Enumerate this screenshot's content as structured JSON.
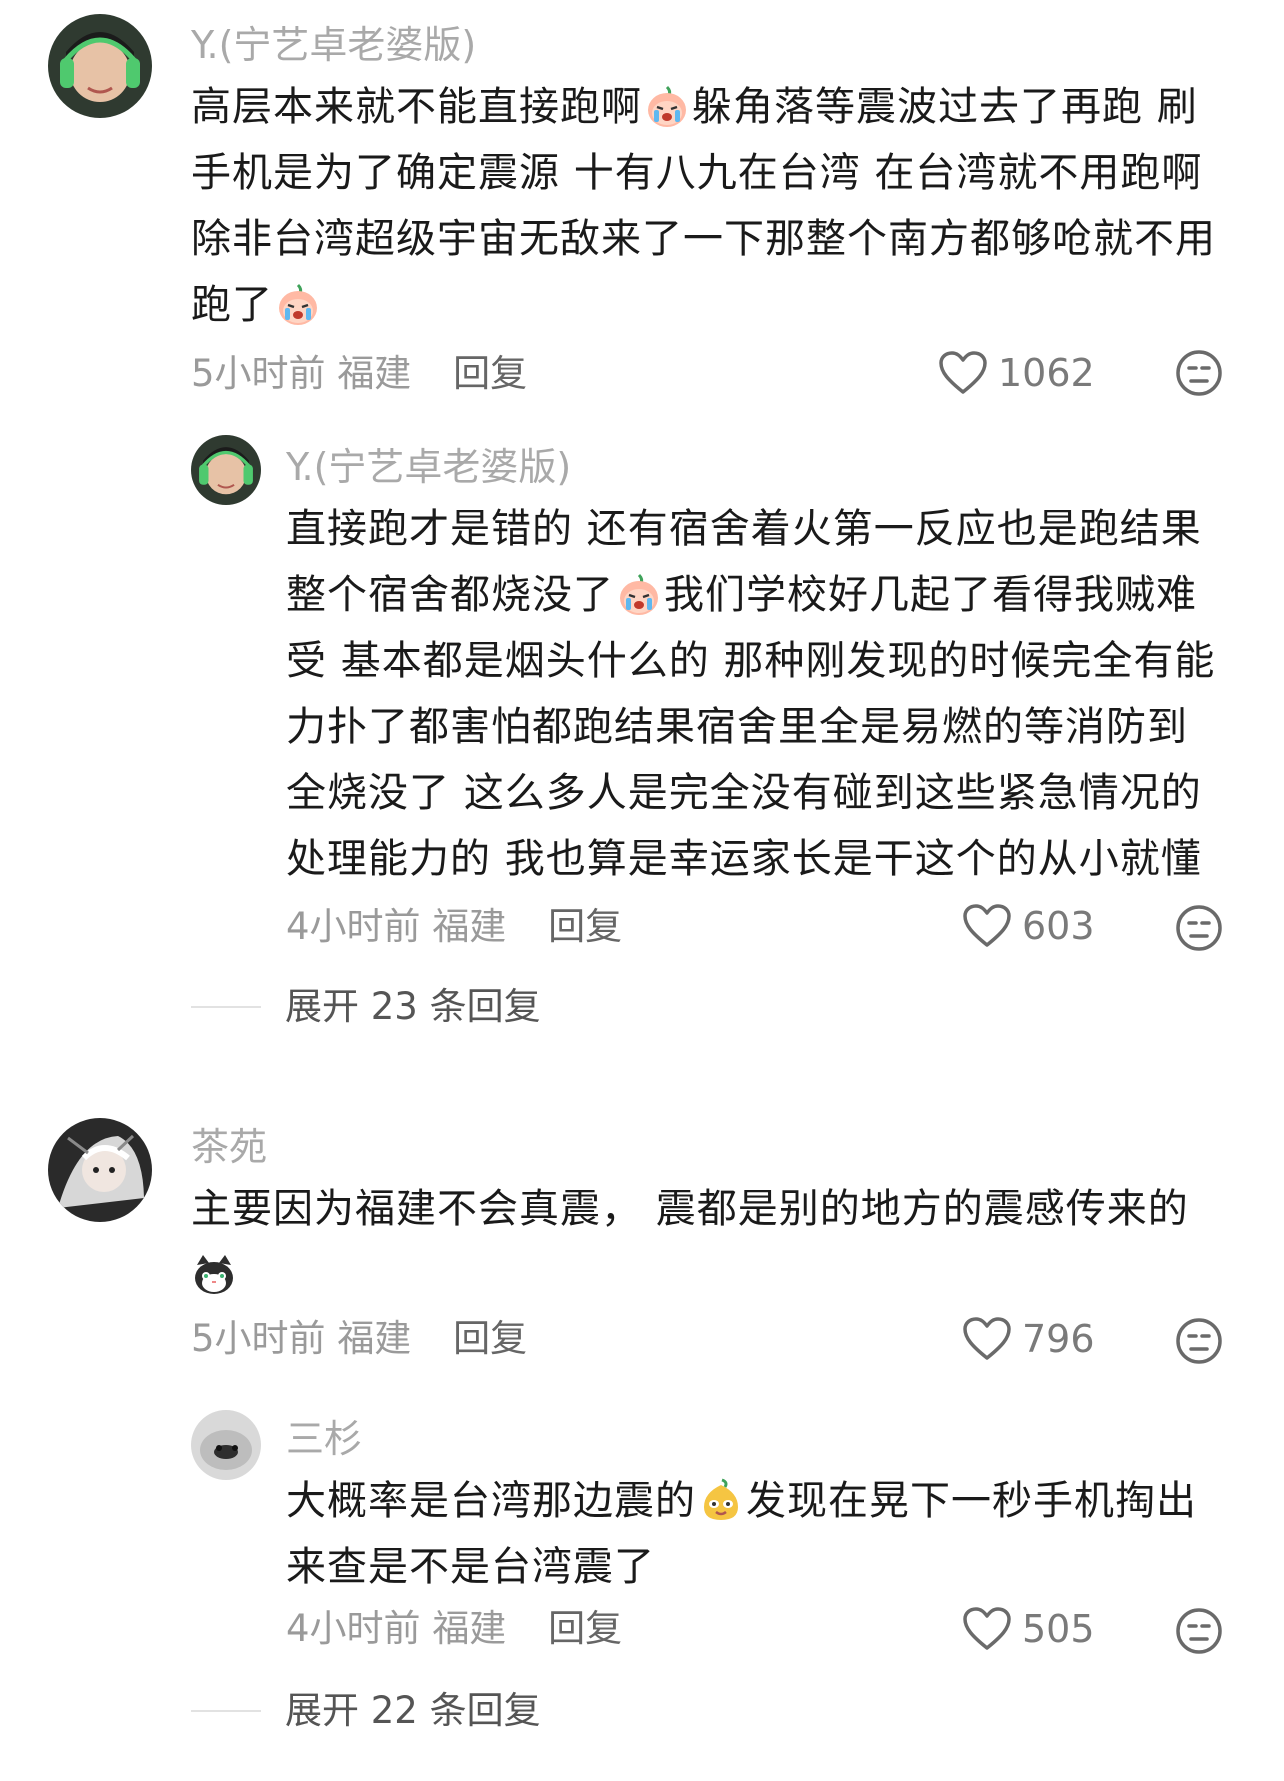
{
  "comments": [
    {
      "username": "Y.(宁艺卓老婆版)",
      "lines": [
        [
          "高层本来就不能直接跑啊",
          "躲角落等震波过去了再跑 刷"
        ],
        [
          "手机是为了确定震源 十有八九在台湾 在台湾就不用跑啊"
        ],
        [
          "除非台湾超级宇宙无敌来了一下那整个南方都够呛就不用"
        ],
        [
          "跑了"
        ]
      ],
      "time": "5小时前",
      "location": "福建",
      "reply_label": "回复",
      "likes": "1062"
    },
    {
      "username": "Y.(宁艺卓老婆版)",
      "lines": [
        [
          "直接跑才是错的 还有宿舍着火第一反应也是跑结果"
        ],
        [
          "整个宿舍都烧没了",
          "我们学校好几起了看得我贼难"
        ],
        [
          "受 基本都是烟头什么的 那种刚发现的时候完全有能"
        ],
        [
          "力扑了都害怕都跑结果宿舍里全是易燃的等消防到"
        ],
        [
          "全烧没了 这么多人是完全没有碰到这些紧急情况的"
        ],
        [
          "处理能力的 我也算是幸运家长是干这个的从小就懂"
        ]
      ],
      "time": "4小时前",
      "location": "福建",
      "reply_label": "回复",
      "likes": "603",
      "expand_label": "展开 23 条回复"
    },
    {
      "username": "茶苑",
      "lines": [
        [
          "主要因为福建不会真震， 震都是别的地方的震感传来的"
        ]
      ],
      "time": "5小时前",
      "location": "福建",
      "reply_label": "回复",
      "likes": "796"
    },
    {
      "username": "三杉",
      "lines": [
        [
          "大概率是台湾那边震的",
          "发现在晃下一秒手机掏出"
        ],
        [
          "来查是不是台湾震了"
        ]
      ],
      "time": "4小时前",
      "location": "福建",
      "reply_label": "回复",
      "likes": "505",
      "expand_label": "展开 22 条回复"
    }
  ]
}
